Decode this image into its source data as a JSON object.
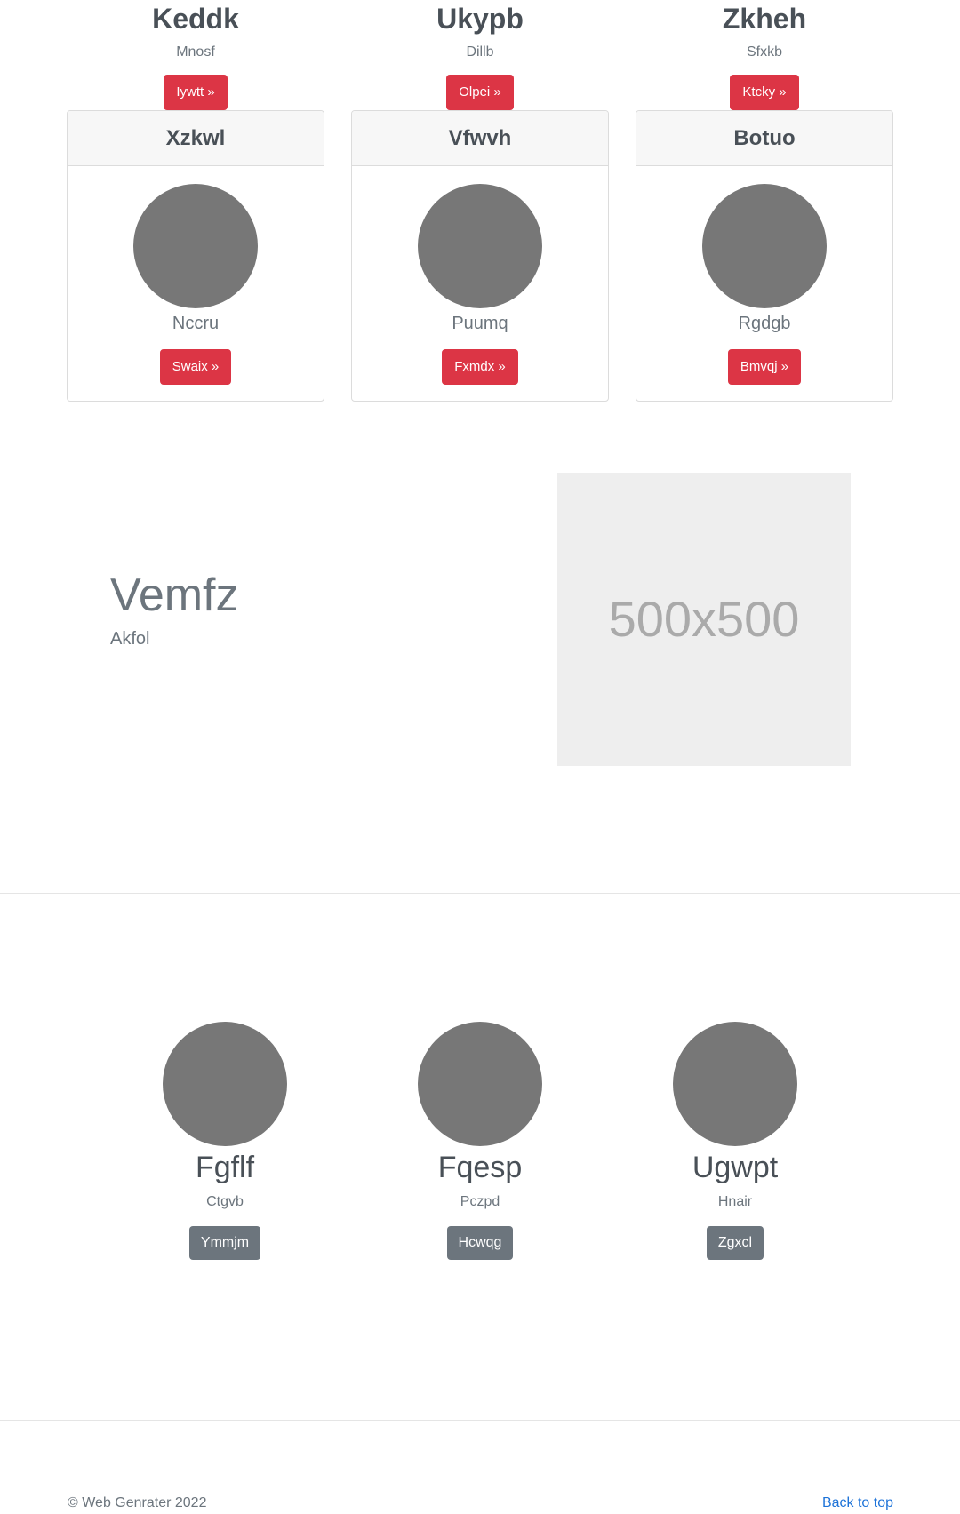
{
  "top_columns": [
    {
      "title": "Keddk",
      "subtitle": "Mnosf",
      "button": "Iywtt »"
    },
    {
      "title": "Ukypb",
      "subtitle": "Dillb",
      "button": "Olpei »"
    },
    {
      "title": "Zkheh",
      "subtitle": "Sfxkb",
      "button": "Ktcky »"
    }
  ],
  "cards": [
    {
      "header": "Xzkwl",
      "name": "Nccru",
      "button": "Swaix »"
    },
    {
      "header": "Vfwvh",
      "name": "Puumq",
      "button": "Fxmdx »"
    },
    {
      "header": "Botuo",
      "name": "Rgdgb",
      "button": "Bmvqj »"
    }
  ],
  "feature": {
    "title": "Vemfz",
    "subtitle": "Akfol",
    "image_label": "500x500"
  },
  "people": [
    {
      "name": "Fgflf",
      "subtitle": "Ctgvb",
      "button": "Ymmjm"
    },
    {
      "name": "Fqesp",
      "subtitle": "Pczpd",
      "button": "Hcwqg"
    },
    {
      "name": "Ugwpt",
      "subtitle": "Hnair",
      "button": "Zgxcl"
    }
  ],
  "footer": {
    "copyright": "© Web Genrater 2022",
    "back_to_top": "Back to top"
  },
  "colors": {
    "accent_red": "#dc3545",
    "button_gray": "#6c757d",
    "avatar_gray": "#777777",
    "link_blue": "#1e73d8"
  }
}
